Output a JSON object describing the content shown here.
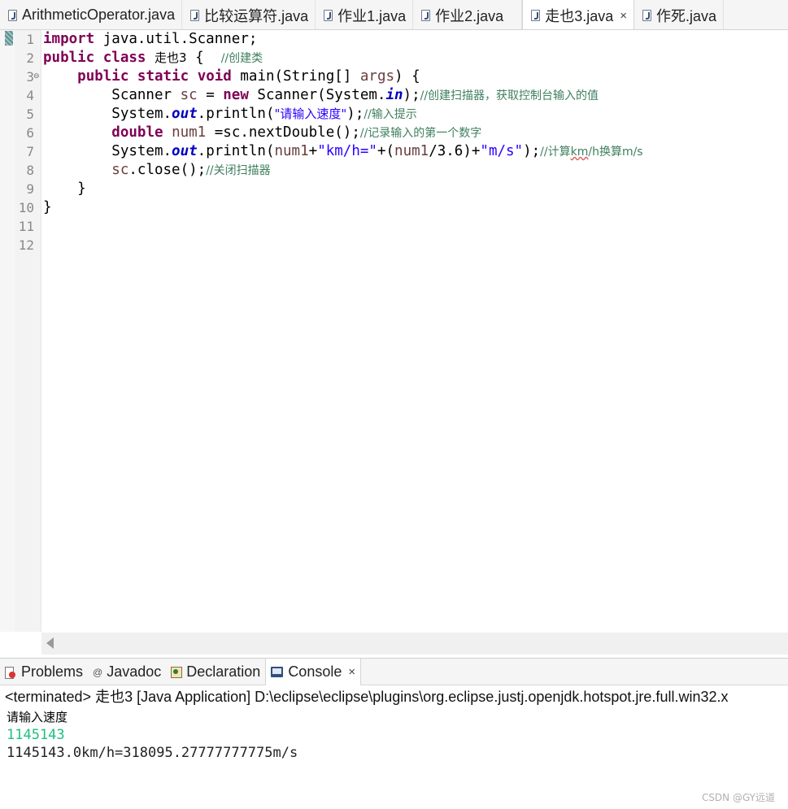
{
  "editor_tabs": [
    {
      "label": "ArithmeticOperator.java",
      "active": false
    },
    {
      "label": "比较运算符.java",
      "active": false
    },
    {
      "label": "作业1.java",
      "active": false
    },
    {
      "label": "作业2.java",
      "active": false
    },
    {
      "label": "走也3.java",
      "active": true,
      "close": "×"
    },
    {
      "label": "作死.java",
      "active": false
    }
  ],
  "line_numbers": [
    "1",
    "2",
    "3",
    "4",
    "5",
    "6",
    "7",
    "8",
    "9",
    "10",
    "11",
    "12"
  ],
  "code": {
    "l1_kw": "import",
    "l1_rest": " java.util.Scanner;",
    "l2_kw1": "public",
    "l2_kw2": "class",
    "l2_name": "走也3",
    "l2_brace": " {  ",
    "l2_cmt": "//创建类",
    "l3_indent": "    ",
    "l3_kw1": "public",
    "l3_kw2": "static",
    "l3_kw3": "void",
    "l3_mid": " main(String[] ",
    "l3_args": "args",
    "l3_end": ") {",
    "l4_a": "        Scanner ",
    "l4_var": "sc",
    "l4_b": " = ",
    "l4_kw": "new",
    "l4_c": " Scanner(System.",
    "l4_fld": "in",
    "l4_d": ");",
    "l4_cmt": "//创建扫描器，获取控制台输入的值",
    "l5_a": "        System.",
    "l5_fld": "out",
    "l5_b": ".println(",
    "l5_str": "\"请输入速度\"",
    "l5_c": ");",
    "l5_cmt": "//输入提示",
    "l6_a": "        ",
    "l6_kw": "double",
    "l6_b": " ",
    "l6_var": "num1",
    "l6_c": " =sc.nextDouble();",
    "l6_cmt": "//记录输入的第一个数字",
    "l7_a": "        System.",
    "l7_fld": "out",
    "l7_b": ".println(",
    "l7_var1": "num1",
    "l7_c": "+",
    "l7_str1": "\"km/h=\"",
    "l7_d": "+(",
    "l7_var2": "num1",
    "l7_e": "/3.6)+",
    "l7_str2": "\"m/s\"",
    "l7_f": ");",
    "l7_cmt_a": "//计算",
    "l7_cmt_b": "km",
    "l7_cmt_c": "/h换算m/s",
    "l8_a": "        ",
    "l8_var": "sc",
    "l8_b": ".close();",
    "l8_cmt": "//关闭扫描器",
    "l9": "    }",
    "l10": "}"
  },
  "view_tabs": [
    {
      "label": "Problems",
      "icon": "problems-icon"
    },
    {
      "label": "Javadoc",
      "icon": "at-icon",
      "glyph": "@"
    },
    {
      "label": "Declaration",
      "icon": "declaration-icon"
    },
    {
      "label": "Console",
      "icon": "console-icon",
      "active": true,
      "close": "×"
    }
  ],
  "console": {
    "status": "<terminated> 走也3 [Java Application] D:\\eclipse\\eclipse\\plugins\\org.eclipse.justj.openjdk.hotspot.jre.full.win32.x",
    "prompt": "请输入速度",
    "input": "1145143",
    "result": "1145143.0km/h=318095.27777777775m/s"
  },
  "watermark": "CSDN @GY远道",
  "colors": {
    "keyword": "#7f0055",
    "string": "#2a00ff",
    "static_field": "#0000c0",
    "local_var": "#6a3e3e",
    "comment": "#3f7f5f",
    "console_input": "#1dc180"
  }
}
